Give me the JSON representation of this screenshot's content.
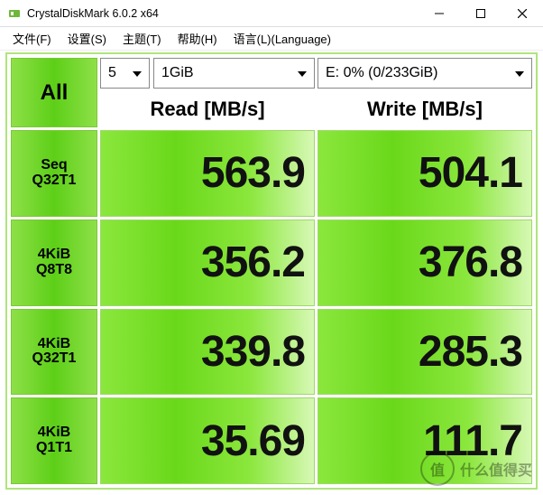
{
  "window": {
    "title": "CrystalDiskMark 6.0.2 x64"
  },
  "menu": {
    "file": "文件(F)",
    "settings": "设置(S)",
    "theme": "主题(T)",
    "help": "帮助(H)",
    "language": "语言(L)(Language)"
  },
  "controls": {
    "loops": "5",
    "test_size": "1GiB",
    "drive": "E: 0% (0/233GiB)",
    "all_label": "All"
  },
  "headers": {
    "read": "Read [MB/s]",
    "write": "Write [MB/s]"
  },
  "tests": [
    {
      "line1": "Seq",
      "line2": "Q32T1",
      "read": "563.9",
      "write": "504.1"
    },
    {
      "line1": "4KiB",
      "line2": "Q8T8",
      "read": "356.2",
      "write": "376.8"
    },
    {
      "line1": "4KiB",
      "line2": "Q32T1",
      "read": "339.8",
      "write": "285.3"
    },
    {
      "line1": "4KiB",
      "line2": "Q1T1",
      "read": "35.69",
      "write": "111.7"
    }
  ],
  "watermark": {
    "symbol": "值",
    "text": "什么值得买"
  },
  "chart_data": {
    "type": "table",
    "title": "CrystalDiskMark 6.0.2 x64",
    "columns": [
      "Test",
      "Read [MB/s]",
      "Write [MB/s]"
    ],
    "rows": [
      [
        "Seq Q32T1",
        563.9,
        504.1
      ],
      [
        "4KiB Q8T8",
        356.2,
        376.8
      ],
      [
        "4KiB Q32T1",
        339.8,
        285.3
      ],
      [
        "4KiB Q1T1",
        35.69,
        111.7
      ]
    ],
    "parameters": {
      "loops": 5,
      "test_size": "1GiB",
      "drive": "E: 0% (0/233GiB)"
    }
  }
}
